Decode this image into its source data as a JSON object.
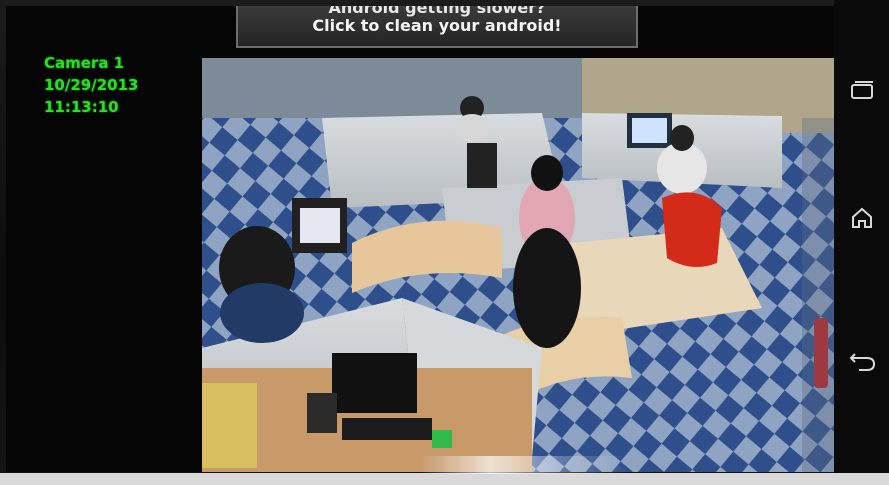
{
  "overlay": {
    "camera_name": "Camera 1",
    "date": "10/29/2013",
    "time": "11:13:10",
    "text_color": "#28e020"
  },
  "ad_banner": {
    "title": "Android getting slower?",
    "subtitle": "Click to clean your android!"
  },
  "system_nav": {
    "overflow_icon": "overflow-menu-icon",
    "recent_icon": "recent-apps-icon",
    "home_icon": "home-icon",
    "back_icon": "back-icon"
  },
  "feed": {
    "content": "security-camera-office-view"
  }
}
